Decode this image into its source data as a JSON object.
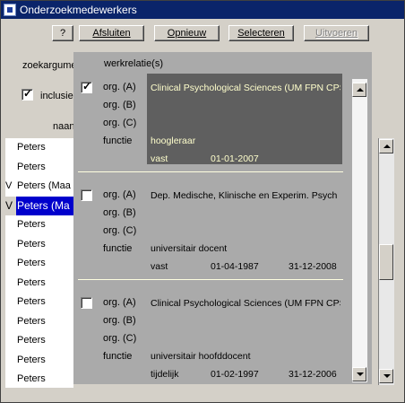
{
  "window": {
    "title": "Onderzoekmedewerkers"
  },
  "toolbar": {
    "help": "?",
    "close": "Afsluiten",
    "reset": "Opnieuw",
    "select": "Selecteren",
    "execute": "Uitvoeren"
  },
  "form": {
    "search_label": "zoekargume",
    "inclusive_label": "inclusie",
    "name_label": "naan",
    "inclusive_checked": true
  },
  "names_list": [
    {
      "mark": "",
      "text": "Peters",
      "selected": false
    },
    {
      "mark": "",
      "text": "Peters",
      "selected": false
    },
    {
      "mark": "V",
      "text": "Peters  (Maa",
      "selected": false
    },
    {
      "mark": "V",
      "text": "Peters  (Ma",
      "selected": true
    },
    {
      "mark": "",
      "text": "Peters",
      "selected": false
    },
    {
      "mark": "",
      "text": "Peters",
      "selected": false
    },
    {
      "mark": "",
      "text": "Peters",
      "selected": false
    },
    {
      "mark": "",
      "text": "Peters",
      "selected": false
    },
    {
      "mark": "",
      "text": "Peters",
      "selected": false
    },
    {
      "mark": "",
      "text": "Peters",
      "selected": false
    },
    {
      "mark": "",
      "text": "Peters",
      "selected": false
    },
    {
      "mark": "",
      "text": "Peters",
      "selected": false
    },
    {
      "mark": "",
      "text": "Peters",
      "selected": false
    }
  ],
  "popup": {
    "title": "werkrelatie(s)",
    "labels": {
      "a": "org. (A)",
      "b": "org. (B)",
      "c": "org. (C)",
      "functie": "functie"
    },
    "records": [
      {
        "checked": true,
        "selected": true,
        "org_a": "Clinical Psychological Sciences (UM FPN CPS",
        "functie": "hoogleraar",
        "type": "vast",
        "start": "01-01-2007",
        "end": ""
      },
      {
        "checked": false,
        "selected": false,
        "org_a": "Dep. Medische, Klinische en Experim. Psych",
        "functie": "universitair docent",
        "type": "vast",
        "start": "01-04-1987",
        "end": "31-12-2008"
      },
      {
        "checked": false,
        "selected": false,
        "org_a": "Clinical Psychological Sciences (UM FPN CPS",
        "functie": "universitair hoofddocent",
        "type": "tijdelijk",
        "start": "01-02-1997",
        "end": "31-12-2006"
      }
    ]
  },
  "icons": {
    "app": "app-window-icon",
    "scroll_up": "arrow-up-icon",
    "scroll_down": "arrow-down-icon"
  }
}
